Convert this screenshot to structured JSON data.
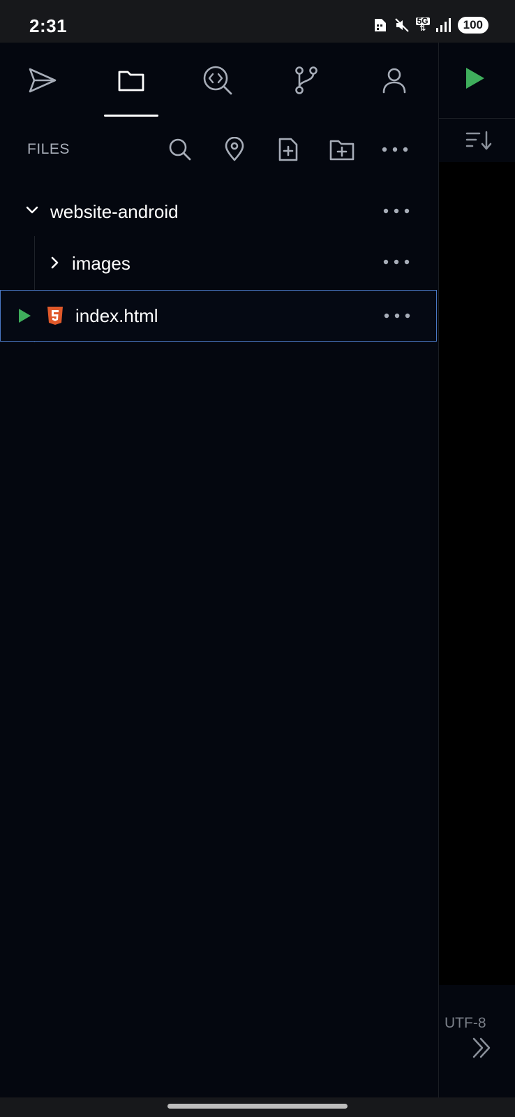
{
  "status_bar": {
    "time": "2:31",
    "network": "5G",
    "battery": "100"
  },
  "colors": {
    "background": "#04070f",
    "accent_green": "#3fae5c",
    "selection_border": "#4a78c4",
    "html_icon": "#e0592a"
  },
  "tabs": [
    {
      "icon": "send-icon"
    },
    {
      "icon": "folder-icon",
      "active": true
    },
    {
      "icon": "code-search-icon"
    },
    {
      "icon": "git-branch-icon"
    },
    {
      "icon": "user-icon"
    }
  ],
  "files_panel": {
    "header": "FILES",
    "tools": [
      "search-icon",
      "location-pin-icon",
      "new-file-icon",
      "new-folder-icon",
      "more-icon"
    ]
  },
  "tree": {
    "root": {
      "label": "website-android",
      "expanded": true
    },
    "folder": {
      "label": "images",
      "expanded": false
    },
    "file": {
      "label": "index.html",
      "selected": true
    }
  },
  "editor": {
    "encoding": "UTF-8"
  }
}
